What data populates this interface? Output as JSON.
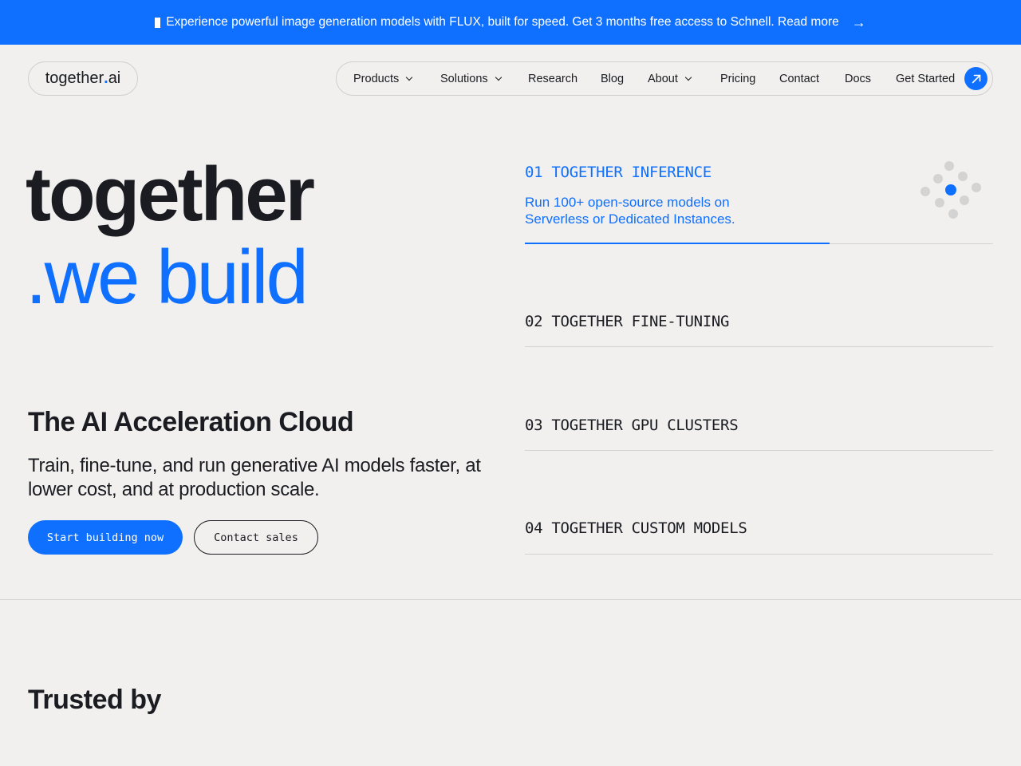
{
  "banner": {
    "text": "Experience powerful image generation models with FLUX, built for speed. Get 3 months free access to Schnell.",
    "link": "Read more",
    "icon": "arrow-right-icon"
  },
  "logo": {
    "prefix": "together",
    "dot": ".",
    "suffix": "ai"
  },
  "nav": {
    "items": [
      {
        "label": "Products",
        "dropdown": true
      },
      {
        "label": "Solutions",
        "dropdown": true
      },
      {
        "label": "Research",
        "dropdown": false
      },
      {
        "label": "Blog",
        "dropdown": false
      },
      {
        "label": "About",
        "dropdown": true
      },
      {
        "label": "Pricing",
        "dropdown": false
      },
      {
        "label": "Contact",
        "dropdown": false
      },
      {
        "label": "Docs",
        "dropdown": false
      }
    ],
    "cta": "Get Started",
    "cta_icon": "arrow-up-right-icon"
  },
  "hero": {
    "line1": "together",
    "line2": ".we build",
    "subhead": "The AI Acceleration Cloud",
    "description": "Train, fine-tune, and run generative AI models faster, at lower cost, and at production scale.",
    "primary_button": "Start building now",
    "secondary_button": "Contact sales"
  },
  "products": [
    {
      "title": "01 TOGETHER INFERENCE",
      "description": "Run 100+ open-source models on Serverless or Dedicated Instances.",
      "active": true,
      "progress": 0.65
    },
    {
      "title": "02 TOGETHER FINE-TUNING",
      "active": false
    },
    {
      "title": "03 TOGETHER GPU CLUSTERS",
      "active": false
    },
    {
      "title": "04 TOGETHER CUSTOM MODELS",
      "active": false
    }
  ],
  "trusted": {
    "heading": "Trusted by"
  },
  "colors": {
    "accent": "#0f6fff",
    "background": "#f1f0ee",
    "text": "#1a1c22",
    "rule": "#d4d3d1"
  }
}
